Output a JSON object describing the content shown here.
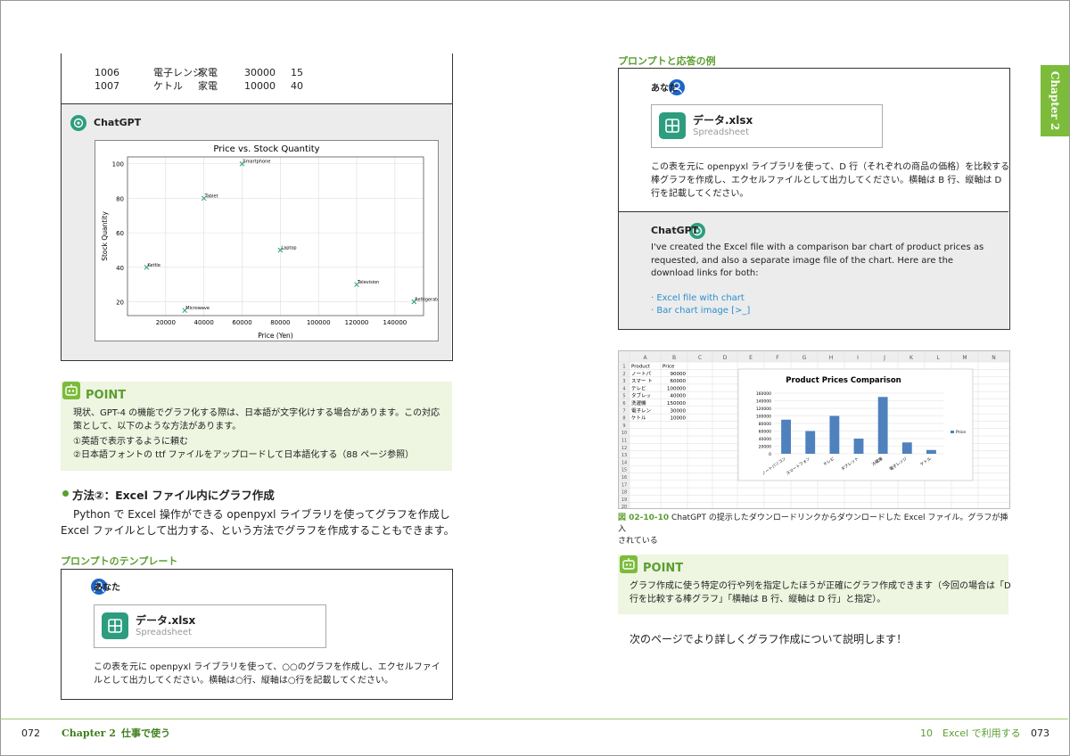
{
  "left": {
    "table_rows": [
      [
        "1006",
        "電子レンジ",
        "家電",
        "30000",
        "15"
      ],
      [
        "1007",
        "ケトル",
        "家電",
        "10000",
        "40"
      ]
    ],
    "chatgpt_label": "ChatGPT",
    "scatter": {
      "title": "Price vs. Stock Quantity",
      "xlabel": "Price (Yen)",
      "ylabel": "Stock Quantity",
      "xticks": [
        "20000",
        "40000",
        "60000",
        "80000",
        "100000",
        "120000",
        "140000"
      ],
      "yticks": [
        "20",
        "40",
        "60",
        "80",
        "100"
      ]
    },
    "point": {
      "title": "POINT",
      "line1": "現状、GPT-4 の機能でグラフ化する際は、日本語が文字化けする場合があります。この対応",
      "line2": "策として、以下のような方法があります。",
      "item1": "①英語で表示するように頼む",
      "item2": "②日本語フォントの ttf ファイルをアップロードして日本語化する（88 ページ参照）"
    },
    "method_heading": "方法②：Excel ファイル内にグラフ作成",
    "body_line1": "Python で Excel 操作ができる openpyxl ライブラリを使ってグラフを作成し",
    "body_line2": "Excel ファイルとして出力する、という方法でグラフを作成することもできます。",
    "template_heading": "プロンプトのテンプレート",
    "user_label": "あなた",
    "file_name": "データ.xlsx",
    "file_type": "Spreadsheet",
    "prompt_line1": "この表を元に openpyxl ライブラリを使って、○○のグラフを作成し、エクセルファイ",
    "prompt_line2": "ルとして出力してください。横軸は○行、縦軸は○行を記載してください。"
  },
  "right": {
    "example_heading": "プロンプトと応答の例",
    "user_label": "あなた",
    "file_name": "データ.xlsx",
    "file_type": "Spreadsheet",
    "prompt_line1": "この表を元に openpyxl ライブラリを使って、D 行（それぞれの商品の価格）を比較する",
    "prompt_line2": "棒グラフを作成し、エクセルファイルとして出力してください。横軸は B 行、縦軸は D",
    "prompt_line3": "行を記載してください。",
    "chatgpt_label": "ChatGPT",
    "reply_line1": "I've created the Excel file with a comparison bar chart of product prices as",
    "reply_line2": "requested, and also a separate image file of the chart. Here are the",
    "reply_line3": "download links for both:",
    "link1": "· Excel file with chart",
    "link2": "· Bar chart image [>_]",
    "excel": {
      "columns": [
        "A",
        "B",
        "C",
        "D",
        "E",
        "F",
        "G",
        "H",
        "I",
        "J",
        "K",
        "L",
        "M",
        "N"
      ],
      "col_a": [
        "Product",
        "ノートパ",
        "スマー ト",
        "テレビ",
        "タブレッ",
        "洗濯機",
        "電子レン",
        "ケトル"
      ],
      "col_b": [
        "Price",
        "90000",
        "60000",
        "100000",
        "40000",
        "150000",
        "30000",
        "10000"
      ],
      "chart_title": "Product Prices Comparison",
      "legend": "Price"
    },
    "caption_num": "図 02-10-10",
    "caption_line1": " ChatGPT の提示したダウンロードリンクからダウンロードした Excel ファイル。グラフが挿入",
    "caption_line2": "されている",
    "point": {
      "title": "POINT",
      "line1": "グラフ作成に使う特定の行や列を指定したほうが正確にグラフ作成できます（今回の場合は「D",
      "line2": "行を比較する棒グラフ」「横軸は B 行、縦軸は D 行」と指定）。"
    },
    "next_page": "次のページでより詳しくグラフ作成について説明します！",
    "side_tab": "Chapter 2"
  },
  "footer": {
    "left_page": "072",
    "left_chapter": "Chapter 2",
    "left_title": "仕事で使う",
    "right_section": "10　Excel で利用する",
    "right_page": "073"
  },
  "chart_data": [
    {
      "type": "scatter",
      "title": "Price vs. Stock Quantity",
      "xlabel": "Price (Yen)",
      "ylabel": "Stock Quantity",
      "xlim": [
        0,
        155000
      ],
      "ylim": [
        12,
        104
      ],
      "points": [
        {
          "label": "Smartphone",
          "x": 60000,
          "y": 100
        },
        {
          "label": "Tablet",
          "x": 40000,
          "y": 80
        },
        {
          "label": "Laptop",
          "x": 80000,
          "y": 50
        },
        {
          "label": "Kettle",
          "x": 10000,
          "y": 40
        },
        {
          "label": "Television",
          "x": 120000,
          "y": 30
        },
        {
          "label": "Refrigerator",
          "x": 150000,
          "y": 20
        },
        {
          "label": "Microwave",
          "x": 30000,
          "y": 15
        }
      ]
    },
    {
      "type": "bar",
      "title": "Product Prices Comparison",
      "categories": [
        "ノートパソコン",
        "スマートフォン",
        "テレビ",
        "タブレット",
        "冷蔵庫",
        "電子レンジ",
        "ケトル"
      ],
      "values": [
        90000,
        60000,
        100000,
        40000,
        150000,
        30000,
        10000
      ],
      "yticks": [
        "0",
        "20000",
        "40000",
        "60000",
        "80000",
        "100000",
        "120000",
        "140000",
        "160000"
      ],
      "ylim": [
        0,
        160000
      ],
      "series_name": "Price"
    }
  ]
}
